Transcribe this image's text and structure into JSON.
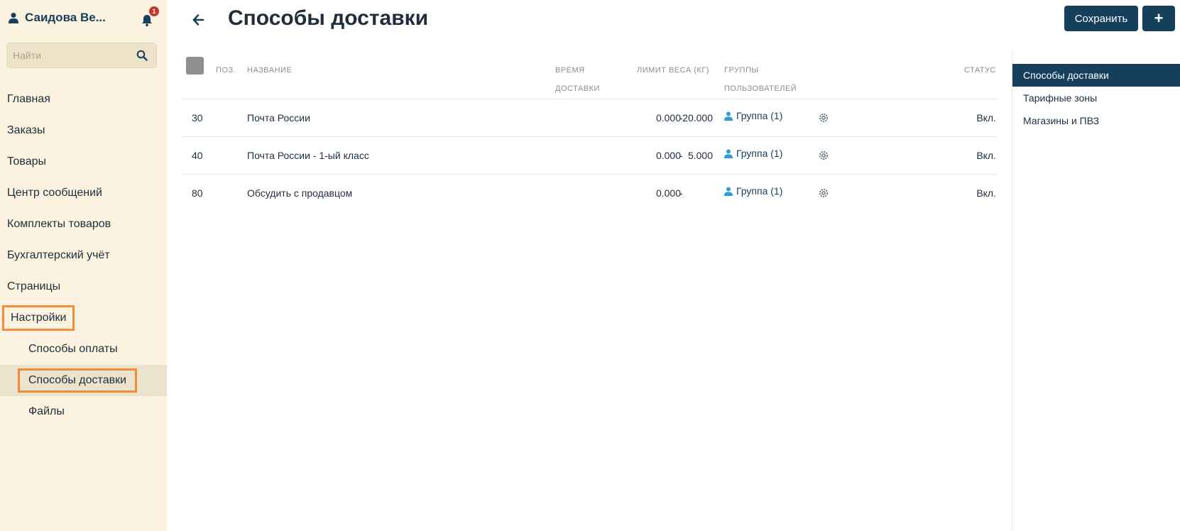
{
  "sidebar": {
    "user_name": "Саидова Ве...",
    "notifications_count": "1",
    "search_placeholder": "Найти",
    "nav": [
      {
        "label": "Главная"
      },
      {
        "label": "Заказы"
      },
      {
        "label": "Товары"
      },
      {
        "label": "Центр сообщений"
      },
      {
        "label": "Комплекты товаров"
      },
      {
        "label": "Бухгалтерский учёт"
      },
      {
        "label": "Страницы"
      },
      {
        "label": "Настройки"
      }
    ],
    "sub_nav": [
      {
        "label": "Способы оплаты"
      },
      {
        "label": "Способы доставки"
      },
      {
        "label": "Файлы"
      }
    ]
  },
  "header": {
    "title": "Способы доставки",
    "save_label": "Сохранить",
    "add_label": "+"
  },
  "table": {
    "headers": {
      "pos": "Поз.",
      "name": "Название",
      "delivery_time_1": "Время",
      "delivery_time_2": "доставки",
      "weight_limit": "Лимит веса (кг)",
      "groups_1": "Группы",
      "groups_2": "пользователей",
      "status": "Статус"
    },
    "rows": [
      {
        "pos": "30",
        "name": "Почта России",
        "weight_min": "0.000",
        "weight_max": "20.000",
        "group": "Группа (1)",
        "status": "Вкл."
      },
      {
        "pos": "40",
        "name": "Почта России - 1-ый класс",
        "weight_min": "0.000",
        "weight_max": "5.000",
        "group": "Группа (1)",
        "status": "Вкл."
      },
      {
        "pos": "80",
        "name": "Обсудить с продавцом",
        "weight_min": "0.000",
        "weight_max": "",
        "group": "Группа (1)",
        "status": "Вкл."
      }
    ]
  },
  "right_panel": {
    "items": [
      {
        "label": "Способы доставки"
      },
      {
        "label": "Тарифные зоны"
      },
      {
        "label": "Магазины и ПВЗ"
      }
    ]
  },
  "colors": {
    "sidebar_bg": "#fbf3df",
    "primary": "#163f5c",
    "highlight": "#f08c3c",
    "user_icon": "#2a9fd6"
  }
}
